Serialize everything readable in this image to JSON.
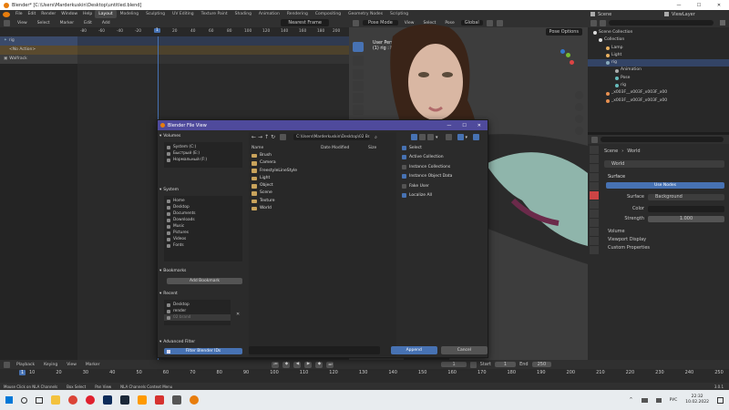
{
  "window": {
    "title": "Blender* [C:\\Users\\Marderkuskin\\Desktop\\untitled.blend]",
    "minimize": "—",
    "maximize": "☐",
    "close": "✕"
  },
  "menubar": {
    "items": [
      "File",
      "Edit",
      "Render",
      "Window",
      "Help"
    ],
    "workspaces": [
      "Layout",
      "Modeling",
      "Sculpting",
      "UV Editing",
      "Texture Paint",
      "Shading",
      "Animation",
      "Rendering",
      "Compositing",
      "Geometry Nodes",
      "Scripting"
    ],
    "active_workspace": "Layout",
    "scene": "Scene",
    "view_layer": "ViewLayer"
  },
  "nla": {
    "menu": [
      "View",
      "Select",
      "Marker",
      "Edit",
      "Add"
    ],
    "filter": "Nearest Frame",
    "ruler": [
      "-80",
      "-60",
      "-40",
      "-20",
      "0",
      "20",
      "40",
      "60",
      "80",
      "100",
      "120",
      "140",
      "160",
      "180",
      "200",
      "220"
    ],
    "frame_marker": "1",
    "tracks": [
      {
        "name": "rig"
      },
      {
        "name": "<No Action>"
      },
      {
        "name": "Walfrack"
      }
    ]
  },
  "viewport": {
    "mode": "Pose Mode",
    "menu": [
      "View",
      "Select",
      "Pose"
    ],
    "orientation": "Global",
    "options": "Pose Options",
    "info1": "User Perspective",
    "info2": "(1) rig : b_L_Squint_..."
  },
  "outliner": {
    "items": [
      {
        "label": "Scene Collection",
        "depth": 0
      },
      {
        "label": "Collection",
        "depth": 1
      },
      {
        "label": "Lamp",
        "depth": 2
      },
      {
        "label": "Light",
        "depth": 2
      },
      {
        "label": "rig",
        "depth": 2
      },
      {
        "label": "Animation",
        "depth": 3
      },
      {
        "label": "Pose",
        "depth": 3
      },
      {
        "label": "rig",
        "depth": 3
      },
      {
        "label": "_x003F__x003F_x003F_x00",
        "depth": 2
      },
      {
        "label": "_x003F__x003F_x003F_x00",
        "depth": 2
      }
    ]
  },
  "properties": {
    "breadcrumb_scene": "Scene",
    "breadcrumb_world": "World",
    "world_name": "World",
    "surface": "Surface",
    "use_nodes": "Use Nodes",
    "surface_label": "Surface",
    "surface_value": "Background",
    "color_label": "Color",
    "strength_label": "Strength",
    "strength_value": "1.000",
    "panels": [
      "Volume",
      "Viewport Display",
      "Custom Properties"
    ]
  },
  "dialog": {
    "title": "Blender File View",
    "volumes_head": "Volumes",
    "volumes": [
      "System (C:)",
      "Быстрый (E:)",
      "Нормальный (F:)"
    ],
    "system_head": "System",
    "system": [
      "Home",
      "Desktop",
      "Documents",
      "Downloads",
      "Music",
      "Pictures",
      "Videos",
      "Fonts"
    ],
    "bookmarks_head": "Bookmarks",
    "add_bookmark": "Add Bookmark",
    "recent_head": "Recent",
    "recent": [
      "Desktop",
      "render",
      "02 brand"
    ],
    "advanced_head": "Advanced Filter",
    "filter_blender": "Filter Blender IDs",
    "path": "C:\\Users\\Marderkuskin\\Desktop\\02 Bra...",
    "columns": {
      "name": "Name",
      "date": "Date Modified",
      "size": "Size"
    },
    "files": [
      "Brush",
      "Camera",
      "FreestyleLineStyle",
      "Light",
      "Object",
      "Scene",
      "Texture",
      "World"
    ],
    "options": [
      {
        "label": "Select",
        "on": true
      },
      {
        "label": "Active Collection",
        "on": true
      },
      {
        "label": "Instance Collections",
        "on": false
      },
      {
        "label": "Instance Object Data",
        "on": true
      },
      {
        "label": "Fake User",
        "on": false
      },
      {
        "label": "Localize All",
        "on": true
      }
    ],
    "filename": "",
    "append": "Append",
    "cancel": "Cancel"
  },
  "timeline": {
    "menu": [
      "Playback",
      "Keying",
      "View",
      "Marker"
    ],
    "current": "1",
    "start_label": "Start",
    "start": "1",
    "end_label": "End",
    "end": "250",
    "ticks": [
      "10",
      "20",
      "30",
      "40",
      "50",
      "60",
      "70",
      "80",
      "90",
      "100",
      "110",
      "120",
      "130",
      "140",
      "150",
      "160",
      "170",
      "180",
      "190",
      "200",
      "210",
      "220",
      "230",
      "240",
      "250"
    ]
  },
  "status": {
    "left1": "Mouse Click on NLA Channels",
    "left2": "Box Select",
    "left3": "Pan View",
    "left4": "NLA Channels Context Menu",
    "version": "3.0.1"
  },
  "taskbar": {
    "time": "22:32",
    "date": "10.02.2022",
    "lang": "РУС"
  }
}
